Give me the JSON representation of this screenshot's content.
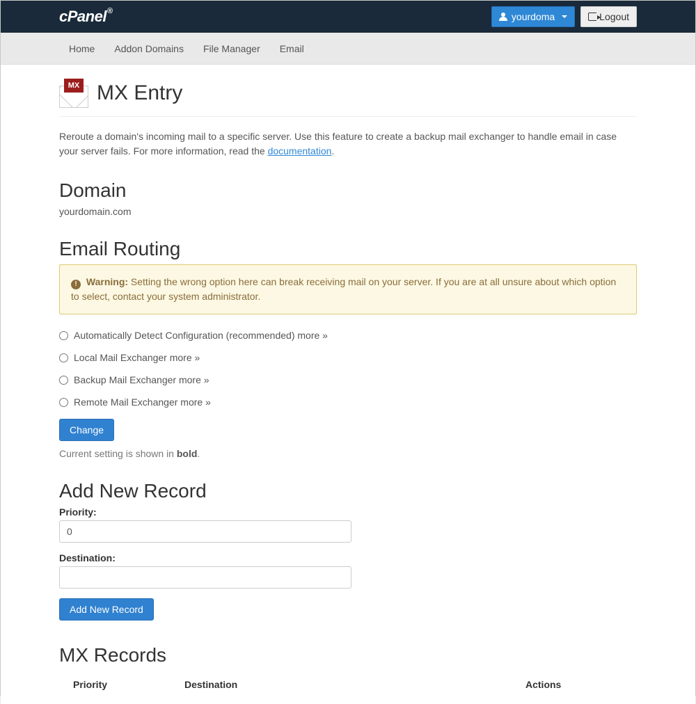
{
  "header": {
    "logo": "cPanel",
    "user": "yourdoma",
    "logout": "Logout"
  },
  "nav": {
    "items": [
      "Home",
      "Addon Domains",
      "File Manager",
      "Email"
    ]
  },
  "page": {
    "icon_badge": "MX",
    "title": "MX Entry",
    "intro_prefix": "Reroute a domain's incoming mail to a specific server. Use this feature to create a backup mail exchanger to handle email in case your server fails. For more information, read the ",
    "intro_link": "documentation",
    "intro_suffix": "."
  },
  "domain": {
    "heading": "Domain",
    "value": "yourdomain.com"
  },
  "routing": {
    "heading": "Email Routing",
    "warning_label": "Warning:",
    "warning_text": " Setting the wrong option here can break receiving mail on your server. If you are at all unsure about which option to select, contact your system administrator.",
    "options": [
      "Automatically Detect Configuration (recommended) more »",
      "Local Mail Exchanger more »",
      "Backup Mail Exchanger more »",
      "Remote Mail Exchanger more »"
    ],
    "change_btn": "Change",
    "hint_prefix": "Current setting is shown in ",
    "hint_bold": "bold",
    "hint_suffix": "."
  },
  "add_record": {
    "heading": "Add New Record",
    "priority_label": "Priority:",
    "priority_value": "0",
    "destination_label": "Destination:",
    "destination_value": "",
    "submit": "Add New Record"
  },
  "records": {
    "heading": "MX Records",
    "cols": {
      "priority": "Priority",
      "destination": "Destination",
      "actions": "Actions"
    }
  }
}
